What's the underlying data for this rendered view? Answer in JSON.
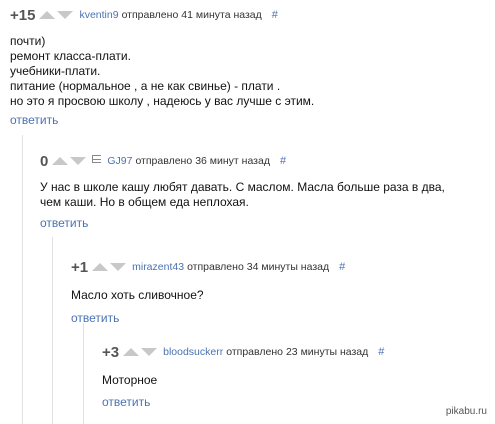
{
  "comments": [
    {
      "rating": "+15",
      "author": "kventin9",
      "sent": "отправлено",
      "time": "41 минута назад",
      "hash": "#",
      "lines": [
        "почти)",
        "ремонт класса-плати.",
        "учебники-плати.",
        "питание (нормальное , а не как свинье) - плати .",
        "но это я просвою школу , надеюсь у вас лучше с этим."
      ],
      "reply": "ответить"
    },
    {
      "rating": "0",
      "author": "GJ97",
      "sent": "отправлено",
      "time": "36 минут назад",
      "hash": "#",
      "lines": [
        "У нас в школе кашу любят давать. С маслом. Масла больше раза в два,",
        "чем каши. Но в общем еда неплохая."
      ],
      "reply": "ответить"
    },
    {
      "rating": "+1",
      "author": "mirazent43",
      "sent": "отправлено",
      "time": "34 минуты назад",
      "hash": "#",
      "lines": [
        "Масло хоть сливочное?"
      ],
      "reply": "ответить"
    },
    {
      "rating": "+3",
      "author": "bloodsuckerr",
      "sent": "отправлено",
      "time": "23 минуты назад",
      "hash": "#",
      "lines": [
        "Моторное"
      ],
      "reply": "ответить"
    }
  ],
  "watermark": "pikabu.ru"
}
